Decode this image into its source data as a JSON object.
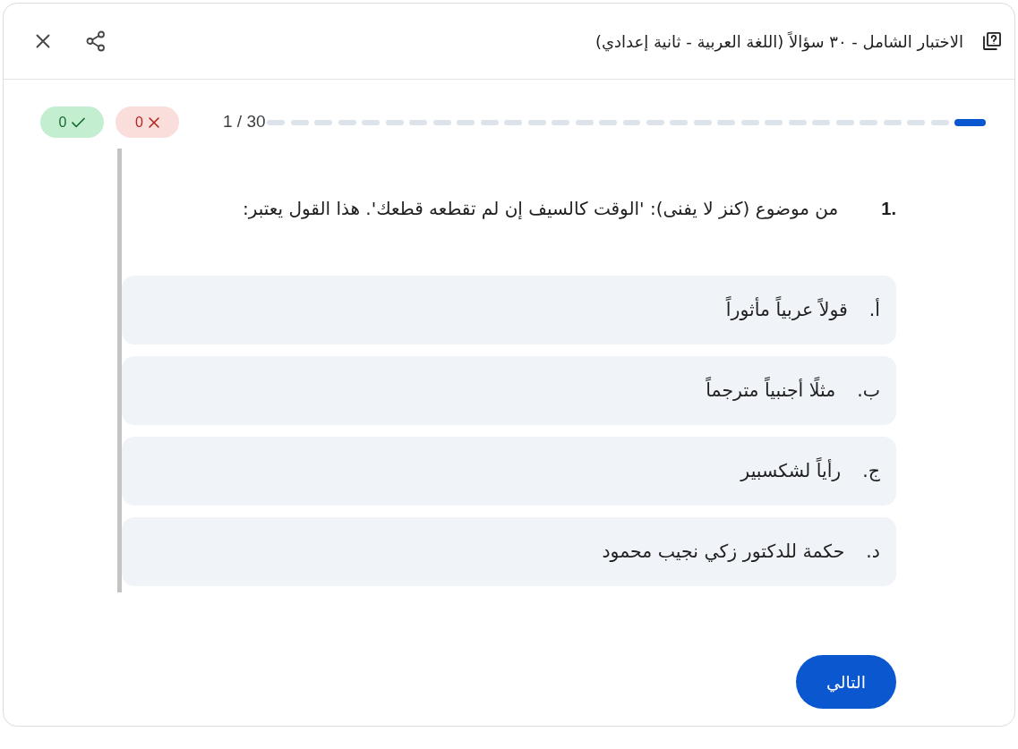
{
  "header": {
    "title": "الاختبار الشامل - ٣٠ سؤالاً (اللغة العربية - ثانية إعدادي)"
  },
  "progress": {
    "segments": [
      {
        "current": true
      },
      {
        "current": false
      },
      {
        "current": false
      },
      {
        "current": false
      },
      {
        "current": false
      },
      {
        "current": false
      },
      {
        "current": false
      },
      {
        "current": false
      },
      {
        "current": false
      },
      {
        "current": false
      },
      {
        "current": false
      },
      {
        "current": false
      },
      {
        "current": false
      },
      {
        "current": false
      },
      {
        "current": false
      },
      {
        "current": false
      },
      {
        "current": false
      },
      {
        "current": false
      },
      {
        "current": false
      },
      {
        "current": false
      },
      {
        "current": false
      },
      {
        "current": false
      },
      {
        "current": false
      },
      {
        "current": false
      },
      {
        "current": false
      },
      {
        "current": false
      },
      {
        "current": false
      },
      {
        "current": false
      },
      {
        "current": false
      },
      {
        "current": false
      }
    ],
    "counter": "1 / 30"
  },
  "score": {
    "wrong": "0",
    "correct": "0"
  },
  "question": {
    "number": "1.",
    "text": "من موضوع (كنز لا يفنى): 'الوقت كالسيف إن لم تقطعه قطعك'. هذا القول يعتبر:",
    "options": [
      {
        "label": "أ.",
        "text": "قولاً عربياً مأثوراً",
        "selected": false
      },
      {
        "label": "ب.",
        "text": "مثلًا أجنبياً مترجماً",
        "selected": false
      },
      {
        "label": "ج.",
        "text": "رأياً لشكسبير",
        "selected": false
      },
      {
        "label": "د.",
        "text": "حكمة للدكتور زكي نجيب محمود",
        "selected": false
      }
    ]
  },
  "next_button": "التالي"
}
